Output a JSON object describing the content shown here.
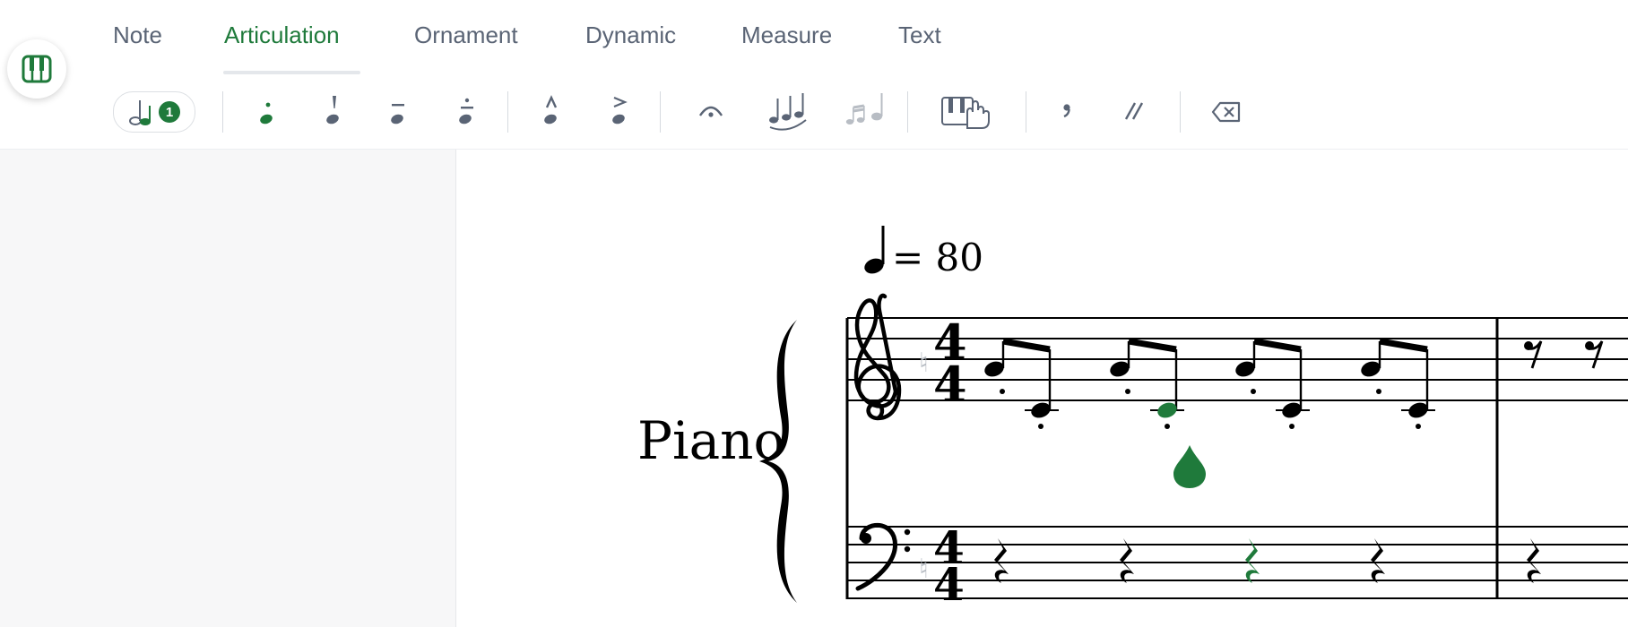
{
  "tabs": [
    {
      "label": "Note",
      "active": false
    },
    {
      "label": "Articulation",
      "active": true
    },
    {
      "label": "Ornament",
      "active": false
    },
    {
      "label": "Dynamic",
      "active": false
    },
    {
      "label": "Measure",
      "active": false
    },
    {
      "label": "Text",
      "active": false
    }
  ],
  "toolbar": {
    "voice_count": "1",
    "items": [
      {
        "name": "staccato-icon",
        "state": "active"
      },
      {
        "name": "staccatissimo-icon",
        "state": "normal"
      },
      {
        "name": "tenuto-icon",
        "state": "normal"
      },
      {
        "name": "tenuto-staccato-icon",
        "state": "normal"
      },
      {
        "name": "marcato-icon",
        "state": "normal"
      },
      {
        "name": "accent-icon",
        "state": "normal"
      },
      {
        "name": "fermata-icon",
        "state": "normal"
      },
      {
        "name": "slur-icon",
        "state": "normal"
      },
      {
        "name": "grace-notes-icon",
        "state": "disabled"
      },
      {
        "name": "fingering-icon",
        "state": "normal"
      },
      {
        "name": "breath-mark-icon",
        "state": "normal"
      },
      {
        "name": "caesura-icon",
        "state": "normal"
      },
      {
        "name": "delete-icon",
        "state": "normal"
      }
    ]
  },
  "score": {
    "tempo": "= 80",
    "instrument": "Piano",
    "time_signature": "4/4",
    "treble_notes": [
      "G",
      "C",
      "G",
      "C",
      "G",
      "C",
      "G",
      "C"
    ],
    "selected_note_index": 3
  },
  "colors": {
    "accent": "#1f7a3b",
    "tab_text": "#5a6475",
    "icon": "#5a6475",
    "icon_disabled": "#b8bdc4"
  }
}
